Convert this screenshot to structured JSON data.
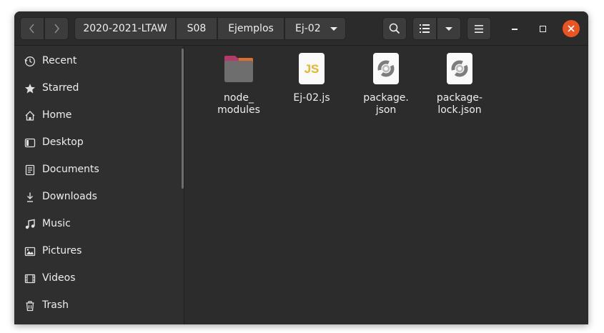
{
  "nav": {
    "back_icon": "chevron-left",
    "forward_icon": "chevron-right"
  },
  "breadcrumb": [
    "2020-2021-LTAW",
    "S08",
    "Ejemplos",
    "Ej-02"
  ],
  "toolbar": {
    "search_icon": "search",
    "view_icon": "list-view",
    "menu_icon": "hamburger"
  },
  "window_controls": {
    "close_color": "#e95420"
  },
  "sidebar": {
    "items": [
      {
        "label": "Recent",
        "icon": "clock"
      },
      {
        "label": "Starred",
        "icon": "star"
      },
      {
        "label": "Home",
        "icon": "home"
      },
      {
        "label": "Desktop",
        "icon": "desktop"
      },
      {
        "label": "Documents",
        "icon": "document"
      },
      {
        "label": "Downloads",
        "icon": "download"
      },
      {
        "label": "Music",
        "icon": "music"
      },
      {
        "label": "Pictures",
        "icon": "picture"
      },
      {
        "label": "Videos",
        "icon": "video"
      },
      {
        "label": "Trash",
        "icon": "trash"
      }
    ]
  },
  "files": [
    {
      "name": "node_\nmodules",
      "type": "folder"
    },
    {
      "name": "Ej-02.js",
      "type": "javascript",
      "badge": "JS"
    },
    {
      "name": "package.\njson",
      "type": "json"
    },
    {
      "name": "package-\nlock.json",
      "type": "json"
    }
  ]
}
